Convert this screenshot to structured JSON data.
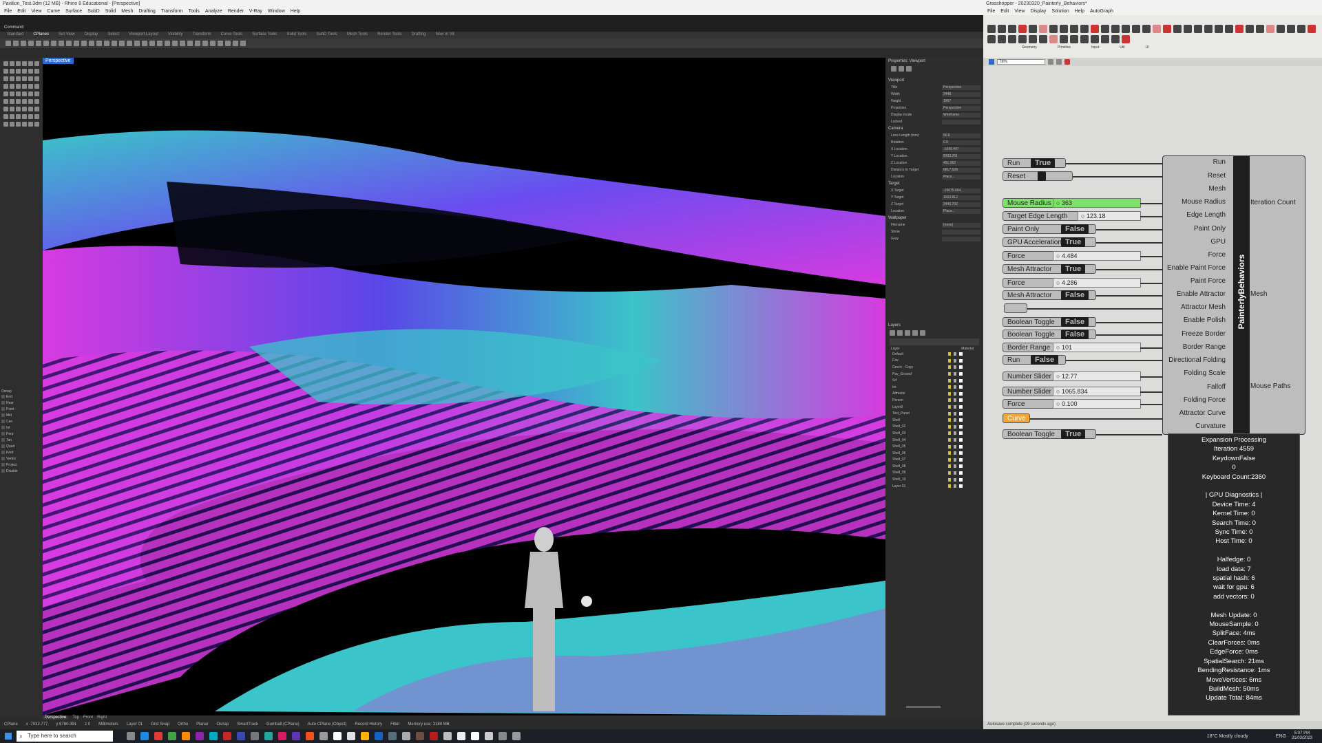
{
  "rhino": {
    "title": "Pavilion_Test.3dm (12 MB) - Rhino 8 Educational - [Perspective]",
    "menu": [
      "File",
      "Edit",
      "View",
      "Curve",
      "Surface",
      "SubD",
      "Solid",
      "Mesh",
      "Drafting",
      "Transform",
      "Tools",
      "Analyze",
      "Render",
      "V-Ray",
      "Window",
      "Help"
    ],
    "command_label": "Command:",
    "tabs": [
      "Standard",
      "CPlanes",
      "Set View",
      "Display",
      "Select",
      "Viewport Layout",
      "Visibility",
      "Transform",
      "Curve Tools",
      "Surface Tools",
      "Solid Tools",
      "SubD Tools",
      "Mesh Tools",
      "Render Tools",
      "Drafting",
      "New in V8"
    ],
    "viewport_label": "Perspective",
    "view_tabs": [
      "Perspective",
      "Top",
      "Front",
      "Right"
    ],
    "properties": {
      "header": "Properties: Viewport",
      "viewport_section": "Viewport",
      "rows": [
        {
          "k": "Title",
          "v": "Perspective"
        },
        {
          "k": "Width",
          "v": "2448"
        },
        {
          "k": "Height",
          "v": "1907"
        },
        {
          "k": "Projection",
          "v": "Perspective"
        },
        {
          "k": "Display mode",
          "v": "Wireframe"
        },
        {
          "k": "Locked",
          "v": ""
        }
      ],
      "camera_section": "Camera",
      "camera_rows": [
        {
          "k": "Lens Length (mm)",
          "v": "50.0"
        },
        {
          "k": "Rotation",
          "v": "0.0"
        },
        {
          "k": "X Location",
          "v": "-1649.447"
        },
        {
          "k": "Y Location",
          "v": "8203.261"
        },
        {
          "k": "Z Location",
          "v": "451.062"
        },
        {
          "k": "Distance to Target",
          "v": "6817.528"
        },
        {
          "k": "Location",
          "v": "Place..."
        }
      ],
      "target_section": "Target",
      "target_rows": [
        {
          "k": "X Target",
          "v": "-15075.664"
        },
        {
          "k": "Y Target",
          "v": "1503.812"
        },
        {
          "k": "Z Target",
          "v": "2440.702"
        },
        {
          "k": "Location",
          "v": "Place..."
        }
      ],
      "wallpaper_section": "Wallpaper",
      "wallpaper_rows": [
        {
          "k": "Filename",
          "v": "(none)"
        },
        {
          "k": "Show",
          "v": ""
        },
        {
          "k": "Gray",
          "v": ""
        }
      ]
    },
    "layers_header": "Layers",
    "layers_columns": [
      "Layer",
      "Material"
    ],
    "layers": [
      "Default",
      "Pav",
      "Green - Copy",
      "Pav_Ground",
      "Srf",
      "Int",
      "Attractor",
      "Person",
      "Layer0",
      "Test_Panel",
      "Shell",
      "Shell_02",
      "Shell_03",
      "Shell_04",
      "Shell_05",
      "Shell_06",
      "Shell_07",
      "Shell_08",
      "Shell_09",
      "Shell_10",
      "Layer 01"
    ],
    "osnap_header": "Osnap",
    "osnaps": [
      "End",
      "Near",
      "Point",
      "Mid",
      "Cen",
      "Int",
      "Perp",
      "Tan",
      "Quad",
      "Knot",
      "Vertex",
      "Project",
      "Disable"
    ],
    "status": [
      "CPlane",
      "x -7032.777",
      "y 8780.391",
      "z 0",
      "Millimeters",
      "Layer 01",
      "Grid Snap",
      "Ortho",
      "Planar",
      "Osnap",
      "SmartTrack",
      "Gumball (CPlane)",
      "Auto CPlane (Object)",
      "Record History",
      "Filter",
      "Memory use: 3180 MB"
    ]
  },
  "grasshopper": {
    "title": "Grasshopper - 20230320_Painterly_Behaviors*",
    "menu": [
      "File",
      "Edit",
      "View",
      "Display",
      "Solution",
      "Help",
      "AutoGraph"
    ],
    "ribbon_groups": [
      "Geometry",
      "Primitive",
      "Input",
      "Util",
      "UI"
    ],
    "zoom": "78%",
    "inputs": [
      {
        "kind": "button",
        "label": "Run",
        "toggle": "True"
      },
      {
        "kind": "button",
        "label": "Reset",
        "toggle": ""
      },
      {
        "kind": "slider",
        "label": "Mouse Radius",
        "value": "363",
        "green": true
      },
      {
        "kind": "slider",
        "label": "Target Edge Length",
        "value": "123.18"
      },
      {
        "kind": "toggle",
        "label": "Paint Only",
        "toggle": "False"
      },
      {
        "kind": "toggle",
        "label": "GPU Acceleration",
        "toggle": "True"
      },
      {
        "kind": "slider",
        "label": "Force",
        "value": "4.484"
      },
      {
        "kind": "toggle",
        "label": "Mesh Attractor",
        "toggle": "True"
      },
      {
        "kind": "slider",
        "label": "Force",
        "value": "4.286"
      },
      {
        "kind": "toggle",
        "label": "Mesh Attractor",
        "toggle": "False"
      },
      {
        "kind": "blank",
        "label": "",
        "toggle": ""
      },
      {
        "kind": "toggle",
        "label": "Boolean Toggle",
        "toggle": "False"
      },
      {
        "kind": "toggle",
        "label": "Boolean Toggle",
        "toggle": "False"
      },
      {
        "kind": "slider",
        "label": "Border Range",
        "value": "101"
      },
      {
        "kind": "toggle",
        "label": "Run",
        "toggle": "False"
      },
      {
        "kind": "slider",
        "label": "Number Slider",
        "value": "12.77"
      },
      {
        "kind": "slider",
        "label": "Number Slider",
        "value": "1065.834"
      },
      {
        "kind": "slider",
        "label": "Force",
        "value": "0.100"
      },
      {
        "kind": "curve",
        "label": "Curve",
        "toggle": ""
      },
      {
        "kind": "toggle",
        "label": "Boolean Toggle",
        "toggle": "True"
      }
    ],
    "component_name": "PainterlyBehaviors",
    "ports_in": [
      "Run",
      "Reset",
      "Mesh",
      "Mouse Radius",
      "Edge Length",
      "Paint Only",
      "GPU",
      "Force",
      "Enable Paint Force",
      "Paint Force",
      "Enable Attractor",
      "Attractor Mesh",
      "Enable Polish",
      "Freeze Border",
      "Border Range",
      "Directional Folding",
      "Folding Scale",
      "Falloff",
      "Folding Force",
      "Attractor Curve",
      "Curvature"
    ],
    "ports_out": [
      "Iteration Count",
      "Mesh",
      "Mouse Paths"
    ],
    "panel_lines": [
      "Expansion Processing",
      "Iteration 4559",
      "KeydownFalse",
      "0",
      "Keyboard Count:2360",
      "",
      "| GPU Diagnostics |",
      "Device Time: 4",
      "Kernel Time: 0",
      "Search Time: 0",
      "Sync Time: 0",
      "Host Time: 0",
      "",
      "Halfedge: 0",
      "load data: 7",
      "spatial hash: 6",
      "wait for gpu: 6",
      "add vectors: 0",
      "",
      "Mesh Update: 0",
      "MouseSample: 0",
      "SplitFace: 4ms",
      "ClearForces: 0ms",
      "EdgeForce: 0ms",
      "SpatialSearch: 21ms",
      "BendingResistance: 1ms",
      "MoveVertices: 6ms",
      "BuildMesh: 50ms",
      "Update Total: 84ms"
    ],
    "status": "Autosave complete (29 seconds ago)"
  },
  "taskbar": {
    "search_placeholder": "Type here to search",
    "weather": "18°C  Mostly cloudy",
    "time": "5:07 PM",
    "date": "21/03/2023",
    "lang": "ENG"
  },
  "colors": {
    "accent": "#2a6bc9",
    "mesh_cyan": "#3bc4c9",
    "mesh_magenta": "#d63be0",
    "mesh_blue": "#6a4cf0",
    "slider_green": "#7ee06a",
    "curve_orange": "#f0a630"
  }
}
